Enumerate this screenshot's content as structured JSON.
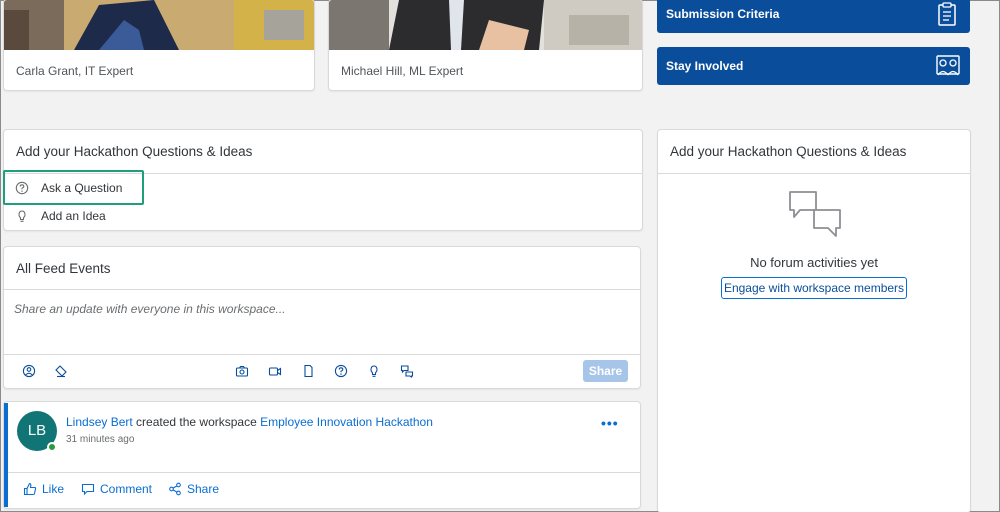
{
  "people": [
    {
      "caption": "Carla Grant, IT Expert"
    },
    {
      "caption": "Michael Hill, ML Expert"
    }
  ],
  "tiles": {
    "submission_label": "Submission Criteria",
    "submission_icon": "clipboard-icon",
    "involved_label": "Stay Involved",
    "involved_icon": "people-network-icon",
    "color": "#0a4e9b"
  },
  "questions_panel": {
    "title": "Add your Hackathon Questions & Ideas",
    "items": [
      {
        "label": "Ask a Question",
        "icon": "question-icon"
      },
      {
        "label": "Add an Idea",
        "icon": "lightbulb-icon"
      }
    ]
  },
  "feed": {
    "title": "All Feed Events",
    "composer_placeholder": "Share an update with everyone in this workspace...",
    "share_button": "Share",
    "toolbar_icons": [
      "mention-icon",
      "tag-icon",
      "camera-icon",
      "video-icon",
      "document-icon",
      "question-icon",
      "lightbulb-icon",
      "discussion-icon"
    ]
  },
  "post": {
    "avatar_initials": "LB",
    "author": "Lindsey Bert",
    "action_text": " created the workspace ",
    "workspace": "Employee Innovation Hackathon",
    "time": "31 minutes ago",
    "more": "•••",
    "actions": {
      "like": "Like",
      "comment": "Comment",
      "share": "Share"
    }
  },
  "forum_panel": {
    "title": "Add your Hackathon Questions & Ideas",
    "empty_text": "No forum activities yet",
    "engage_button": "Engage with workspace members"
  },
  "colors": {
    "accent": "#0a6ed1",
    "highlight": "#1f9e7a",
    "avatar_bg": "#127575"
  }
}
